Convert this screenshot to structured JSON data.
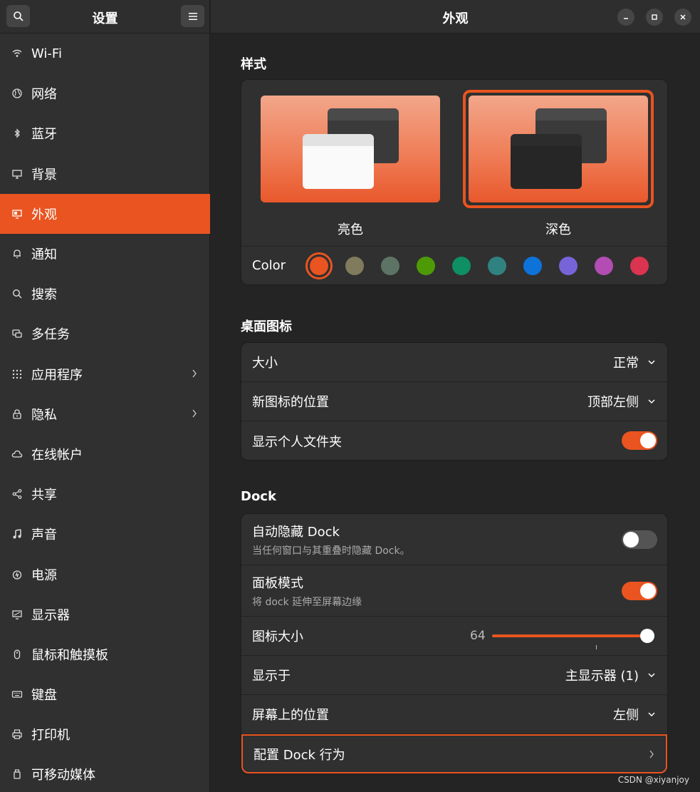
{
  "sidebar": {
    "title": "设置",
    "items": [
      {
        "label": "Wi-Fi",
        "icon": "wifi-icon",
        "chevron": false
      },
      {
        "label": "网络",
        "icon": "globe-icon",
        "chevron": false
      },
      {
        "label": "蓝牙",
        "icon": "bluetooth-icon",
        "chevron": false
      },
      {
        "label": "背景",
        "icon": "monitor-icon",
        "chevron": false
      },
      {
        "label": "外观",
        "icon": "appearance-icon",
        "chevron": false,
        "active": true
      },
      {
        "label": "通知",
        "icon": "bell-icon",
        "chevron": false
      },
      {
        "label": "搜索",
        "icon": "search-icon",
        "chevron": false
      },
      {
        "label": "多任务",
        "icon": "multitask-icon",
        "chevron": false
      },
      {
        "label": "应用程序",
        "icon": "apps-grid-icon",
        "chevron": true
      },
      {
        "label": "隐私",
        "icon": "lock-icon",
        "chevron": true
      },
      {
        "label": "在线帐户",
        "icon": "cloud-icon",
        "chevron": false
      },
      {
        "label": "共享",
        "icon": "share-icon",
        "chevron": false
      },
      {
        "label": "声音",
        "icon": "music-note-icon",
        "chevron": false
      },
      {
        "label": "电源",
        "icon": "power-icon",
        "chevron": false
      },
      {
        "label": "显示器",
        "icon": "display-icon",
        "chevron": false
      },
      {
        "label": "鼠标和触摸板",
        "icon": "mouse-icon",
        "chevron": false
      },
      {
        "label": "键盘",
        "icon": "keyboard-icon",
        "chevron": false
      },
      {
        "label": "打印机",
        "icon": "printer-icon",
        "chevron": false
      },
      {
        "label": "可移动媒体",
        "icon": "usb-drive-icon",
        "chevron": false
      }
    ]
  },
  "header": {
    "title": "外观"
  },
  "style": {
    "section_title": "样式",
    "light_label": "亮色",
    "dark_label": "深色",
    "selected": "dark",
    "color_label": "Color",
    "accent_colors": [
      "#e95420",
      "#7f7b5c",
      "#5d7464",
      "#4e9a06",
      "#0e8f64",
      "#308280",
      "#0d73d9",
      "#7764d8",
      "#b34cb3",
      "#da3450"
    ],
    "selected_color": "#e95420"
  },
  "desktop_icons": {
    "section_title": "桌面图标",
    "size_label": "大小",
    "size_value": "正常",
    "position_label": "新图标的位置",
    "position_value": "顶部左侧",
    "show_home_label": "显示个人文件夹",
    "show_home_on": true
  },
  "dock": {
    "section_title": "Dock",
    "autohide_label": "自动隐藏 Dock",
    "autohide_sub": "当任何窗口与其重叠时隐藏 Dock。",
    "autohide_on": false,
    "panel_label": "面板模式",
    "panel_sub": "将 dock 延伸至屏幕边缘",
    "panel_on": true,
    "icon_size_label": "图标大小",
    "icon_size_value": "64",
    "icon_size_fraction": 1.0,
    "show_on_label": "显示于",
    "show_on_value": "主显示器 (1)",
    "screen_pos_label": "屏幕上的位置",
    "screen_pos_value": "左侧",
    "configure_label": "配置 Dock 行为"
  },
  "watermark": "CSDN @xiyanjoy"
}
